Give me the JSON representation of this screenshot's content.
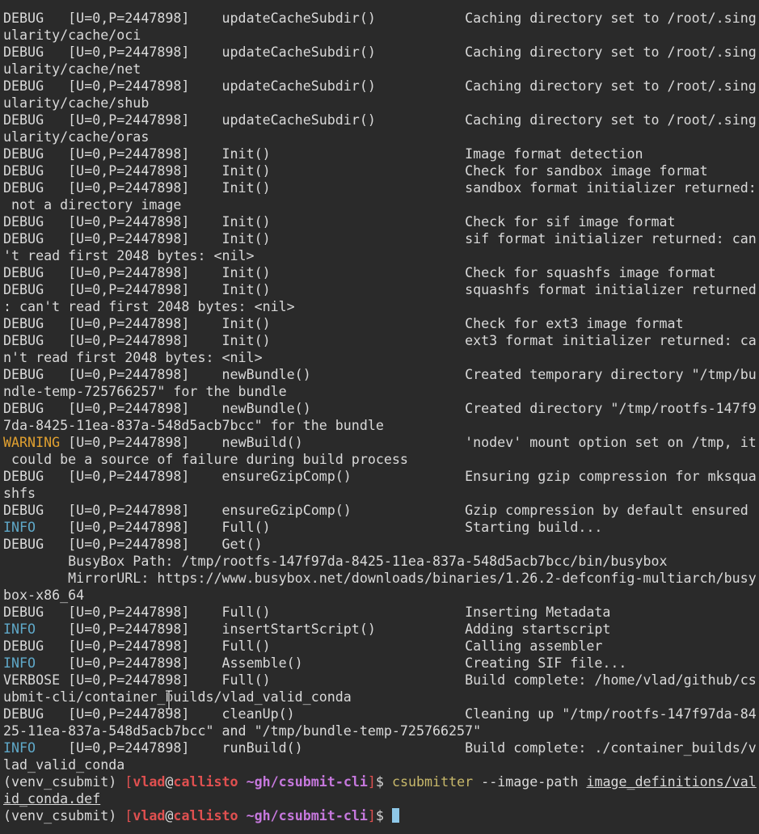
{
  "terminal": {
    "rows": [
      {
        "type": "log",
        "level": "DEBUG",
        "pad": "   ",
        "ids": "[U=0,P=2447898]",
        "fn": "updateCacheSubdir()",
        "msg": "Caching directory set to /root/.sing"
      },
      {
        "type": "cont",
        "text": "ularity/cache/oci"
      },
      {
        "type": "log",
        "level": "DEBUG",
        "pad": "   ",
        "ids": "[U=0,P=2447898]",
        "fn": "updateCacheSubdir()",
        "msg": "Caching directory set to /root/.sing"
      },
      {
        "type": "cont",
        "text": "ularity/cache/net"
      },
      {
        "type": "log",
        "level": "DEBUG",
        "pad": "   ",
        "ids": "[U=0,P=2447898]",
        "fn": "updateCacheSubdir()",
        "msg": "Caching directory set to /root/.sing"
      },
      {
        "type": "cont",
        "text": "ularity/cache/shub"
      },
      {
        "type": "log",
        "level": "DEBUG",
        "pad": "   ",
        "ids": "[U=0,P=2447898]",
        "fn": "updateCacheSubdir()",
        "msg": "Caching directory set to /root/.sing"
      },
      {
        "type": "cont",
        "text": "ularity/cache/oras"
      },
      {
        "type": "log",
        "level": "DEBUG",
        "pad": "   ",
        "ids": "[U=0,P=2447898]",
        "fn": "Init()",
        "msg": "Image format detection"
      },
      {
        "type": "log",
        "level": "DEBUG",
        "pad": "   ",
        "ids": "[U=0,P=2447898]",
        "fn": "Init()",
        "msg": "Check for sandbox image format"
      },
      {
        "type": "log",
        "level": "DEBUG",
        "pad": "   ",
        "ids": "[U=0,P=2447898]",
        "fn": "Init()",
        "msg": "sandbox format initializer returned:"
      },
      {
        "type": "cont",
        "text": " not a directory image"
      },
      {
        "type": "log",
        "level": "DEBUG",
        "pad": "   ",
        "ids": "[U=0,P=2447898]",
        "fn": "Init()",
        "msg": "Check for sif image format"
      },
      {
        "type": "log",
        "level": "DEBUG",
        "pad": "   ",
        "ids": "[U=0,P=2447898]",
        "fn": "Init()",
        "msg": "sif format initializer returned: can"
      },
      {
        "type": "cont",
        "text": "'t read first 2048 bytes: <nil>"
      },
      {
        "type": "log",
        "level": "DEBUG",
        "pad": "   ",
        "ids": "[U=0,P=2447898]",
        "fn": "Init()",
        "msg": "Check for squashfs image format"
      },
      {
        "type": "log",
        "level": "DEBUG",
        "pad": "   ",
        "ids": "[U=0,P=2447898]",
        "fn": "Init()",
        "msg": "squashfs format initializer returned"
      },
      {
        "type": "cont",
        "text": ": can't read first 2048 bytes: <nil>"
      },
      {
        "type": "log",
        "level": "DEBUG",
        "pad": "   ",
        "ids": "[U=0,P=2447898]",
        "fn": "Init()",
        "msg": "Check for ext3 image format"
      },
      {
        "type": "log",
        "level": "DEBUG",
        "pad": "   ",
        "ids": "[U=0,P=2447898]",
        "fn": "Init()",
        "msg": "ext3 format initializer returned: ca"
      },
      {
        "type": "cont",
        "text": "n't read first 2048 bytes: <nil>"
      },
      {
        "type": "log",
        "level": "DEBUG",
        "pad": "   ",
        "ids": "[U=0,P=2447898]",
        "fn": "newBundle()",
        "msg": "Created temporary directory \"/tmp/bu"
      },
      {
        "type": "cont",
        "text": "ndle-temp-725766257\" for the bundle"
      },
      {
        "type": "log",
        "level": "DEBUG",
        "pad": "   ",
        "ids": "[U=0,P=2447898]",
        "fn": "newBundle()",
        "msg": "Created directory \"/tmp/rootfs-147f9"
      },
      {
        "type": "cont",
        "text": "7da-8425-11ea-837a-548d5acb7bcc\" for the bundle"
      },
      {
        "type": "log",
        "level": "WARNING",
        "pad": " ",
        "ids": "[U=0,P=2447898]",
        "fn": "newBuild()",
        "msg": "'nodev' mount option set on /tmp, it"
      },
      {
        "type": "cont",
        "text": " could be a source of failure during build process"
      },
      {
        "type": "log",
        "level": "DEBUG",
        "pad": "   ",
        "ids": "[U=0,P=2447898]",
        "fn": "ensureGzipComp()",
        "msg": "Ensuring gzip compression for mksqua"
      },
      {
        "type": "cont",
        "text": "shfs"
      },
      {
        "type": "log",
        "level": "DEBUG",
        "pad": "   ",
        "ids": "[U=0,P=2447898]",
        "fn": "ensureGzipComp()",
        "msg": "Gzip compression by default ensured"
      },
      {
        "type": "log",
        "level": "INFO",
        "pad": "    ",
        "ids": "[U=0,P=2447898]",
        "fn": "Full()",
        "msg": "Starting build..."
      },
      {
        "type": "log",
        "level": "DEBUG",
        "pad": "   ",
        "ids": "[U=0,P=2447898]",
        "fn": "Get()",
        "msg": ""
      },
      {
        "type": "cont",
        "text": "        BusyBox Path: /tmp/rootfs-147f97da-8425-11ea-837a-548d5acb7bcc/bin/busybox"
      },
      {
        "type": "cont",
        "text": "        MirrorURL: https://www.busybox.net/downloads/binaries/1.26.2-defconfig-multiarch/busy"
      },
      {
        "type": "cont",
        "text": "box-x86_64"
      },
      {
        "type": "log",
        "level": "DEBUG",
        "pad": "   ",
        "ids": "[U=0,P=2447898]",
        "fn": "Full()",
        "msg": "Inserting Metadata"
      },
      {
        "type": "log",
        "level": "INFO",
        "pad": "    ",
        "ids": "[U=0,P=2447898]",
        "fn": "insertStartScript()",
        "msg": "Adding startscript"
      },
      {
        "type": "log",
        "level": "DEBUG",
        "pad": "   ",
        "ids": "[U=0,P=2447898]",
        "fn": "Full()",
        "msg": "Calling assembler"
      },
      {
        "type": "log",
        "level": "INFO",
        "pad": "    ",
        "ids": "[U=0,P=2447898]",
        "fn": "Assemble()",
        "msg": "Creating SIF file..."
      },
      {
        "type": "log",
        "level": "VERBOSE",
        "pad": " ",
        "ids": "[U=0,P=2447898]",
        "fn": "Full()",
        "msg": "Build complete: /home/vlad/github/cs"
      },
      {
        "type": "cont",
        "text": "ubmit-cli/container_builds/vlad_valid_conda"
      },
      {
        "type": "log",
        "level": "DEBUG",
        "pad": "   ",
        "ids": "[U=0,P=2447898]",
        "fn": "cleanUp()",
        "msg": "Cleaning up \"/tmp/rootfs-147f97da-84"
      },
      {
        "type": "cont",
        "text": "25-11ea-837a-548d5acb7bcc\" and \"/tmp/bundle-temp-725766257\""
      },
      {
        "type": "log",
        "level": "INFO",
        "pad": "    ",
        "ids": "[U=0,P=2447898]",
        "fn": "runBuild()",
        "msg": "Build complete: ./container_builds/v"
      },
      {
        "type": "cont",
        "text": "lad_valid_conda"
      },
      {
        "type": "prompt",
        "venv": "(venv_csubmit) ",
        "user": "vlad",
        "at": "@",
        "host": "callisto",
        "path": "~gh/csubmit-cli",
        "dollar": "$ ",
        "cmd": "csubmitter",
        "args": " --image-path ",
        "uarg": "image_definitions/val"
      },
      {
        "type": "ucont",
        "text": "id_conda.def"
      },
      {
        "type": "prompt",
        "venv": "(venv_csubmit) ",
        "user": "vlad",
        "at": "@",
        "host": "callisto",
        "path": "~gh/csubmit-cli",
        "dollar": "$ ",
        "cmd": "",
        "args": "",
        "uarg": "",
        "cursor": true
      }
    ]
  },
  "colors": {
    "background": "#2a2a2a",
    "foreground": "#d9d9d9",
    "info": "#5fa8c8",
    "warning": "#e0a030",
    "prompt_red": "#e05050",
    "prompt_path": "#c678dd",
    "command": "#c8b86a",
    "cursor": "#8ec8e8"
  }
}
